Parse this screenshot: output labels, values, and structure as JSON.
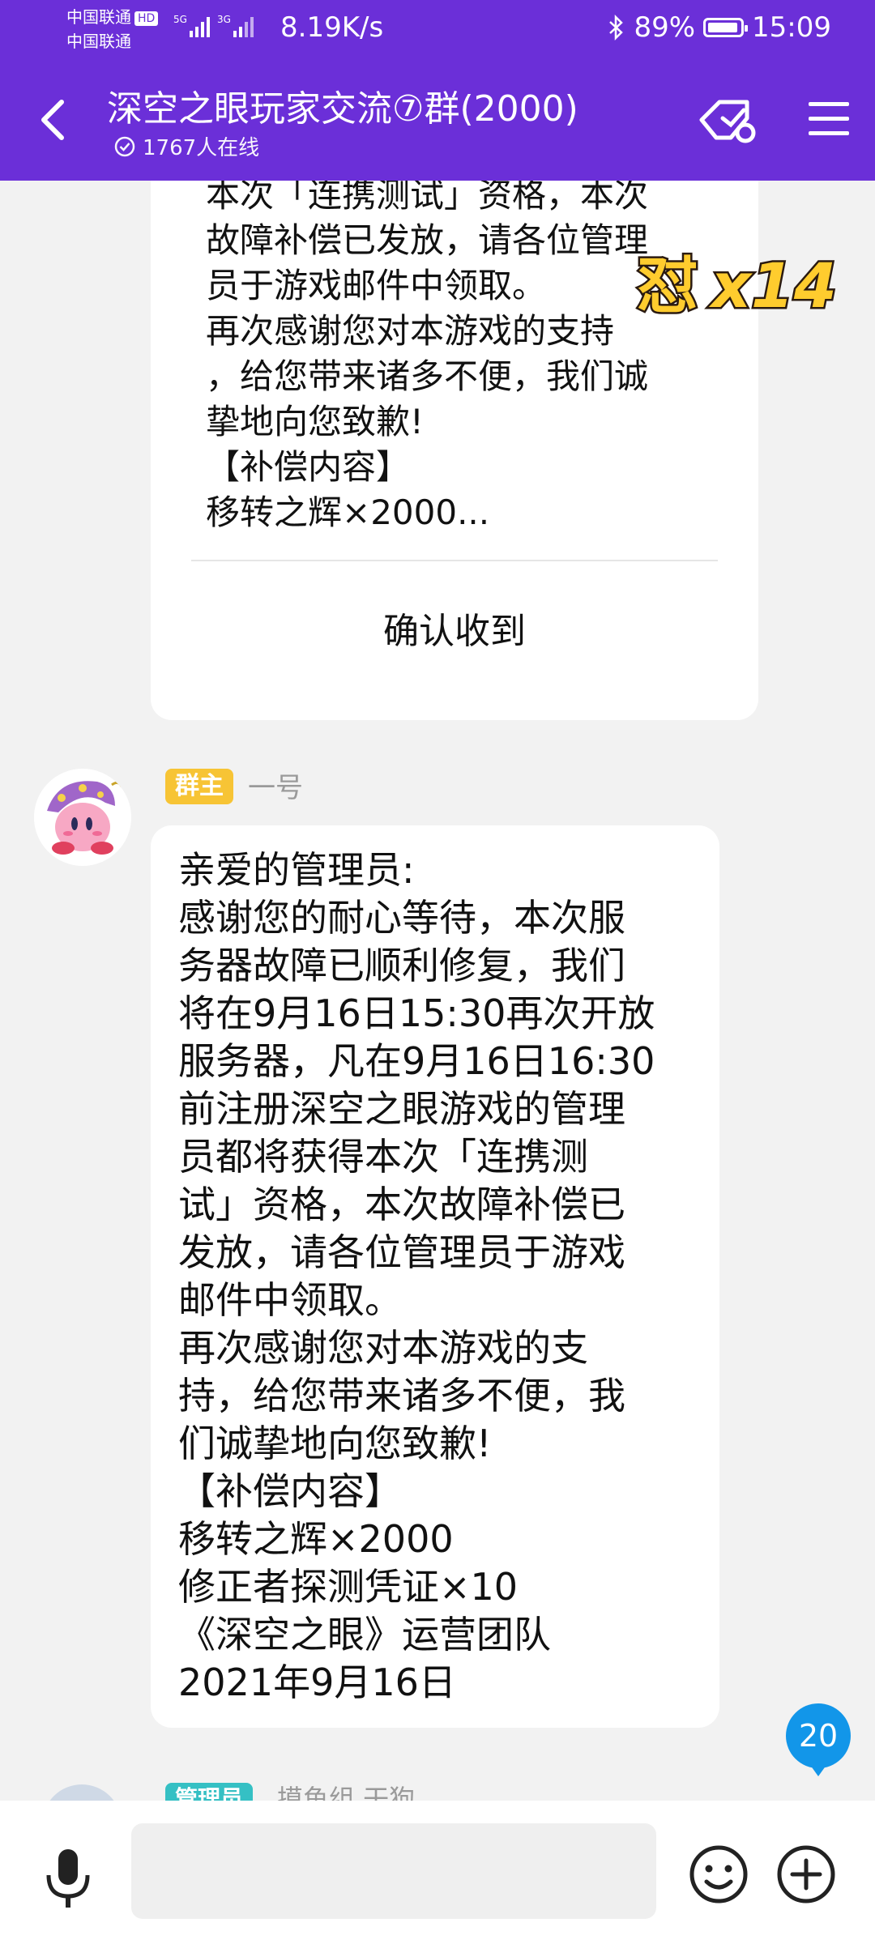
{
  "status_bar": {
    "carrier_1": "中国联通",
    "carrier_1_badge": "HD",
    "carrier_2": "中国联通",
    "network_1": "5G",
    "network_2": "3G",
    "speed": "8.19K/s",
    "battery_percent": "89%",
    "time": "15:09",
    "icons": [
      "signal-icon",
      "bluetooth-icon",
      "battery-icon"
    ]
  },
  "header": {
    "title": "深空之眼玩家交流⑦群(2000)",
    "online": "1767人在线",
    "icons": [
      "back-arrow-icon",
      "check-circle-icon",
      "sign-in-icon",
      "menu-icon"
    ]
  },
  "announcement_card": {
    "text": "本次「连携测试」资格，本次\n故障补偿已发放，请各位管理\n员于游戏邮件中领取。\n再次感谢您对本游戏的支持\n，给您带来诸多不便，我们诚\n挚地向您致歉!\n【补偿内容】\n移转之辉×2000...",
    "confirm_label": "确认收到"
  },
  "sticker": {
    "char": "怼",
    "count": "x14"
  },
  "message": {
    "role": "群主",
    "sender": "一号",
    "text": "亲爱的管理员:\n感谢您的耐心等待，本次服\n务器故障已顺利修复，我们\n将在9月16日15:30再次开放\n服务器，凡在9月16日16:30\n前注册深空之眼游戏的管理\n员都将获得本次「连携测\n试」资格，本次故障补偿已\n发放，请各位管理员于游戏\n邮件中领取。\n再次感谢您对本游戏的支\n持，给您带来诸多不便，我\n们诚挚地向您致歉!\n【补偿内容】\n移转之辉×2000\n修正者探测凭证×10\n《深空之眼》运营团队\n2021年9月16日"
  },
  "unread_badge": "20",
  "next_message": {
    "role": "管理员",
    "sender": "摸鱼组 干狗"
  },
  "input_bar": {
    "placeholder": "",
    "icons": [
      "microphone-icon",
      "emoji-icon",
      "plus-icon"
    ]
  },
  "colors": {
    "header_bg": "#6b2fd8",
    "chat_bg": "#f2f2f2",
    "owner_badge": "#f7c435",
    "admin_badge": "#35c0c4",
    "unread_badge": "#1296e9"
  }
}
